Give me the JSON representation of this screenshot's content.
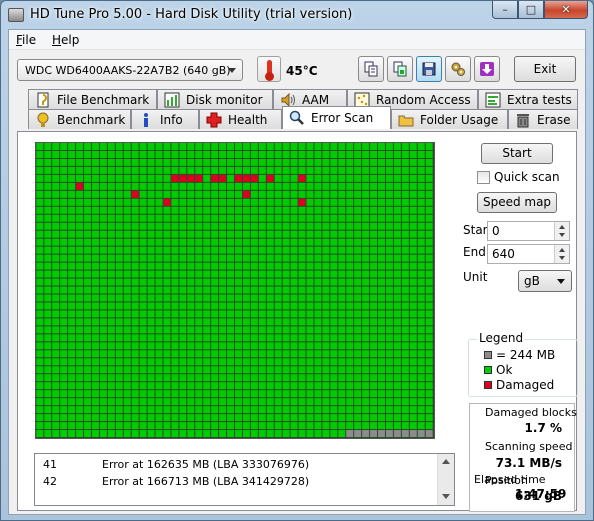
{
  "window": {
    "title": "HD Tune Pro 5.00 - Hard Disk Utility (trial version)",
    "min_glyph": "–",
    "max_glyph": "□",
    "close_glyph": "✕"
  },
  "menu": {
    "file_key": "F",
    "file_rest": "ile",
    "help_key": "H",
    "help_rest": "elp"
  },
  "toolbar": {
    "drive": "WDC WD6400AAKS-22A7B2 (640 gB)",
    "temperature": "45°C",
    "exit_label": "Exit"
  },
  "tabs": {
    "row1": [
      "File Benchmark",
      "Disk monitor",
      "AAM",
      "Random Access",
      "Extra tests"
    ],
    "row2": [
      "Benchmark",
      "Info",
      "Health",
      "Error Scan",
      "Folder Usage",
      "Erase"
    ],
    "selected": "Error Scan"
  },
  "scan": {
    "grid_cols": 50,
    "grid_rows": 37,
    "scanned_blocks": 1839,
    "damaged_cells": [
      [
        4,
        17
      ],
      [
        4,
        18
      ],
      [
        4,
        19
      ],
      [
        4,
        20
      ],
      [
        4,
        22
      ],
      [
        4,
        23
      ],
      [
        4,
        25
      ],
      [
        4,
        26
      ],
      [
        4,
        27
      ],
      [
        4,
        29
      ],
      [
        4,
        33
      ],
      [
        5,
        5
      ],
      [
        6,
        12
      ],
      [
        6,
        26
      ],
      [
        7,
        16
      ],
      [
        7,
        33
      ]
    ],
    "colors": {
      "ok": "#00cc00",
      "damaged": "#dd0022",
      "unscanned": "#8c8c8c",
      "gridline": "#2a4a2a"
    }
  },
  "controls": {
    "start_button": "Start",
    "quick_scan": "Quick scan",
    "quick_scan_checked": false,
    "speed_map_button": "Speed map",
    "start_label": "Start",
    "start_value": "0",
    "end_label": "End",
    "end_value": "640",
    "unit_label": "Unit",
    "unit_value": "gB"
  },
  "legend": {
    "title": "Legend",
    "block_size": "= 244 MB",
    "ok": "Ok",
    "damaged": "Damaged"
  },
  "stats": {
    "damaged_label": "Damaged blocks",
    "damaged_value": "1.7 %",
    "speed_label": "Scanning speed",
    "speed_value": "73.1 MB/s",
    "position_label": "Position",
    "position_value": "631 gB",
    "elapsed_label": "Elapsed time",
    "elapsed_value": "1:47:59"
  },
  "log": [
    {
      "num": "41",
      "msg": "Error at 162635 MB (LBA 333076976)"
    },
    {
      "num": "42",
      "msg": "Error at 166713 MB (LBA 341429728)"
    }
  ]
}
